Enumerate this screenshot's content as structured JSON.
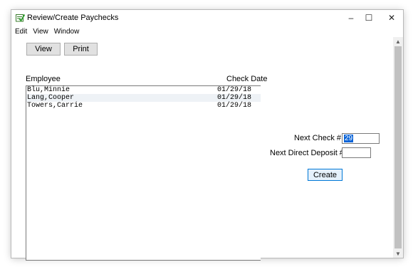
{
  "window": {
    "title": "Review/Create Paychecks",
    "controls": {
      "minimize": "–",
      "maximize": "☐",
      "close": "✕"
    }
  },
  "menu": {
    "items": [
      "Edit",
      "View",
      "Window"
    ]
  },
  "toolbar": {
    "view_label": "View",
    "print_label": "Print"
  },
  "list": {
    "headers": {
      "employee": "Employee",
      "check_date": "Check Date"
    },
    "rows": [
      {
        "employee": "Blu,Minnie",
        "check_date": "01/29/18"
      },
      {
        "employee": "Lang,Cooper",
        "check_date": "01/29/18"
      },
      {
        "employee": "Towers,Carrie",
        "check_date": "01/29/18"
      }
    ]
  },
  "form": {
    "next_check_label": "Next Check #",
    "next_check_value": "29",
    "next_direct_deposit_label": "Next Direct Deposit #",
    "next_direct_deposit_value": "",
    "create_label": "Create"
  },
  "scrollbar": {
    "up_arrow": "▲",
    "down_arrow": "▼"
  },
  "colors": {
    "selection": "#0a64d8",
    "button_face": "#e1e1e1",
    "default_button_border": "#0078d7",
    "scroll_thumb": "#c1c1c1"
  }
}
